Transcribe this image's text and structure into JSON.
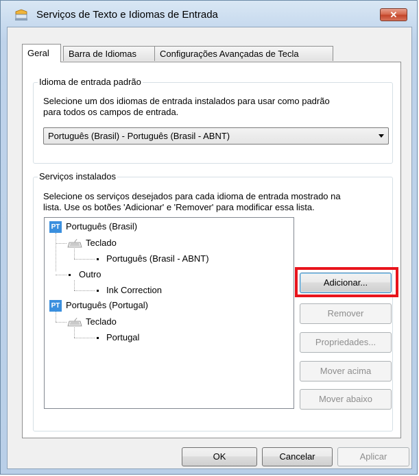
{
  "window": {
    "title": "Serviços de Texto e Idiomas de Entrada",
    "close_label": "✕"
  },
  "tabs": [
    {
      "label": "Geral",
      "active": true
    },
    {
      "label": "Barra de Idiomas",
      "active": false
    },
    {
      "label": "Configurações Avançadas de Tecla",
      "active": false
    }
  ],
  "default_language": {
    "legend": "Idioma de entrada padrão",
    "description_line1": "Selecione um dos idiomas de entrada instalados para usar como padrão",
    "description_line2": "para todos os campos de entrada.",
    "selected": "Português (Brasil) - Português (Brasil - ABNT)"
  },
  "installed_services": {
    "legend": "Serviços instalados",
    "description_line1": "Selecione os serviços desejados para cada idioma de entrada mostrado na",
    "description_line2": "lista. Use os botões 'Adicionar' e 'Remover' para modificar essa lista.",
    "badge": "PT",
    "tree": {
      "lang1": "Português (Brasil)",
      "lang1_keyboard": "Teclado",
      "lang1_layout": "Português (Brasil - ABNT)",
      "lang1_other": "Outro",
      "lang1_other_item": "Ink Correction",
      "lang2": "Português (Portugal)",
      "lang2_keyboard": "Teclado",
      "lang2_layout": "Portugal"
    },
    "buttons": {
      "add": "Adicionar...",
      "remove": "Remover",
      "properties": "Propriedades...",
      "move_up": "Mover acima",
      "move_down": "Mover abaixo"
    }
  },
  "footer": {
    "ok": "OK",
    "cancel": "Cancelar",
    "apply": "Aplicar"
  },
  "colors": {
    "highlight": "#e8141c",
    "badge": "#3a8fde"
  }
}
